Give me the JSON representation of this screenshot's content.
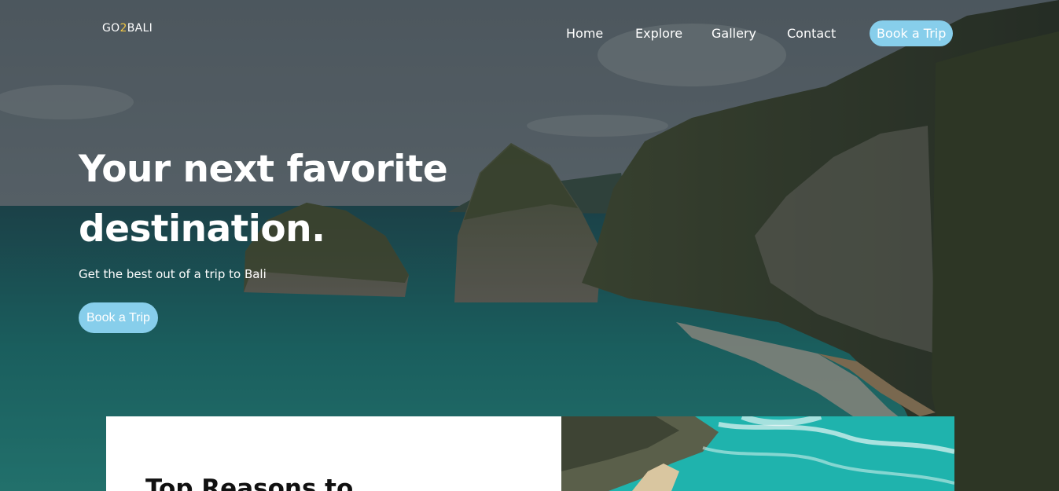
{
  "brand": {
    "prefix": "GO",
    "accent": "2",
    "suffix": "BALI"
  },
  "nav": {
    "home": "Home",
    "explore": "Explore",
    "gallery": "Gallery",
    "contact": "Contact",
    "cta": "Book a Trip"
  },
  "hero": {
    "title": "Your next favorite destination.",
    "subtitle": "Get the best out of a trip to Bali",
    "cta": "Book a Trip"
  },
  "section": {
    "heading": "Top Reasons to"
  },
  "colors": {
    "accent": "#87ceeb",
    "brand_accent": "#f2c744",
    "text": "#ffffff"
  }
}
